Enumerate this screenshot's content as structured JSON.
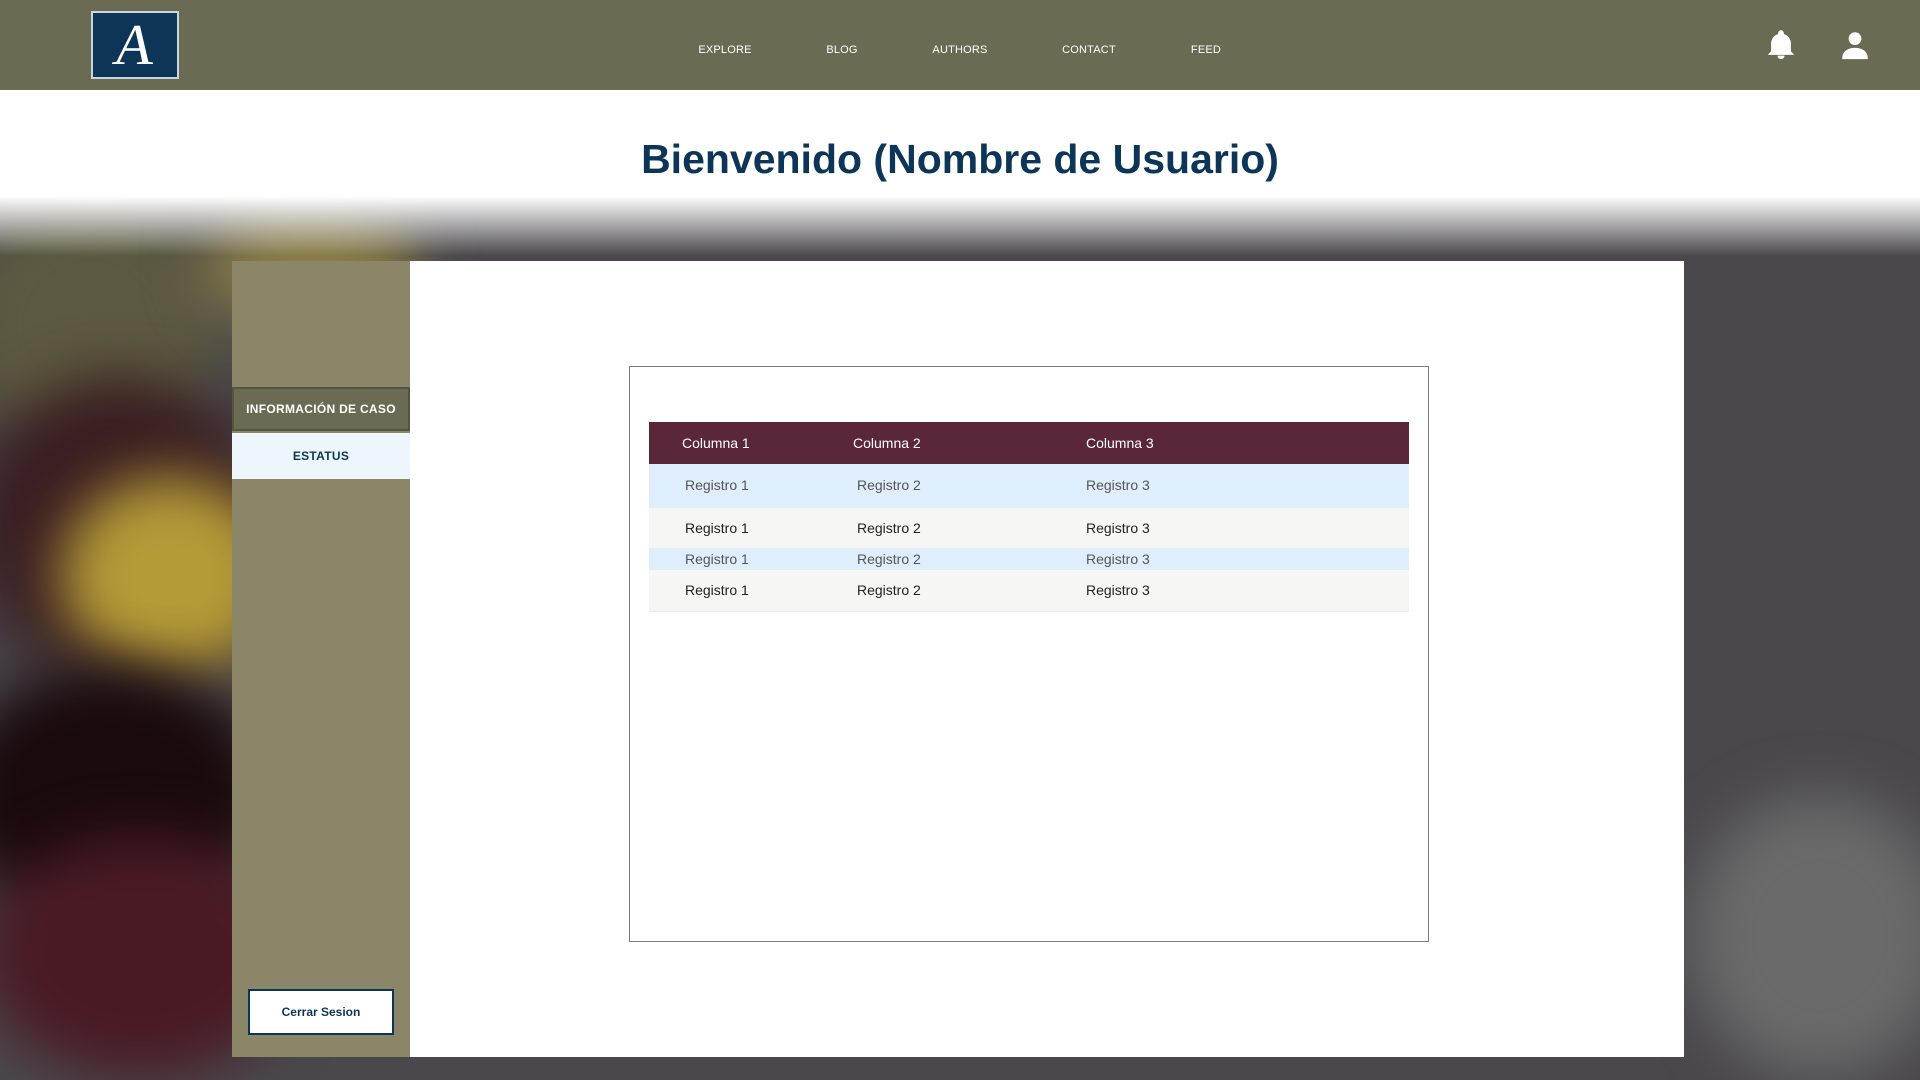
{
  "header": {
    "logo_letter": "A",
    "nav": [
      "EXPLORE",
      "BLOG",
      "AUTHORS",
      "CONTACT",
      "FEED"
    ],
    "icons": [
      "bell-icon",
      "user-icon"
    ]
  },
  "welcome": "Bienvenido (Nombre de Usuario)",
  "sidebar": {
    "items": [
      {
        "label": "INFORMACIÓN DE CASO"
      },
      {
        "label": "ESTATUS"
      }
    ],
    "logout_label": "Cerrar Sesion"
  },
  "table": {
    "columns": [
      "Columna 1",
      "Columna 2",
      "Columna 3"
    ],
    "rows": [
      [
        "Registro 1",
        "Registro 2",
        "Registro 3"
      ],
      [
        "Registro 1",
        "Registro 2",
        "Registro 3"
      ],
      [
        "Registro 1",
        "Registro 2",
        "Registro 3"
      ],
      [
        "Registro 1",
        "Registro 2",
        "Registro 3"
      ]
    ]
  },
  "colors": {
    "topbar": "#6b6a52",
    "sidebar": "#8b8668",
    "accent_navy": "#0c3557",
    "table_header": "#5a2639",
    "row_highlight": "#dfeefc"
  }
}
